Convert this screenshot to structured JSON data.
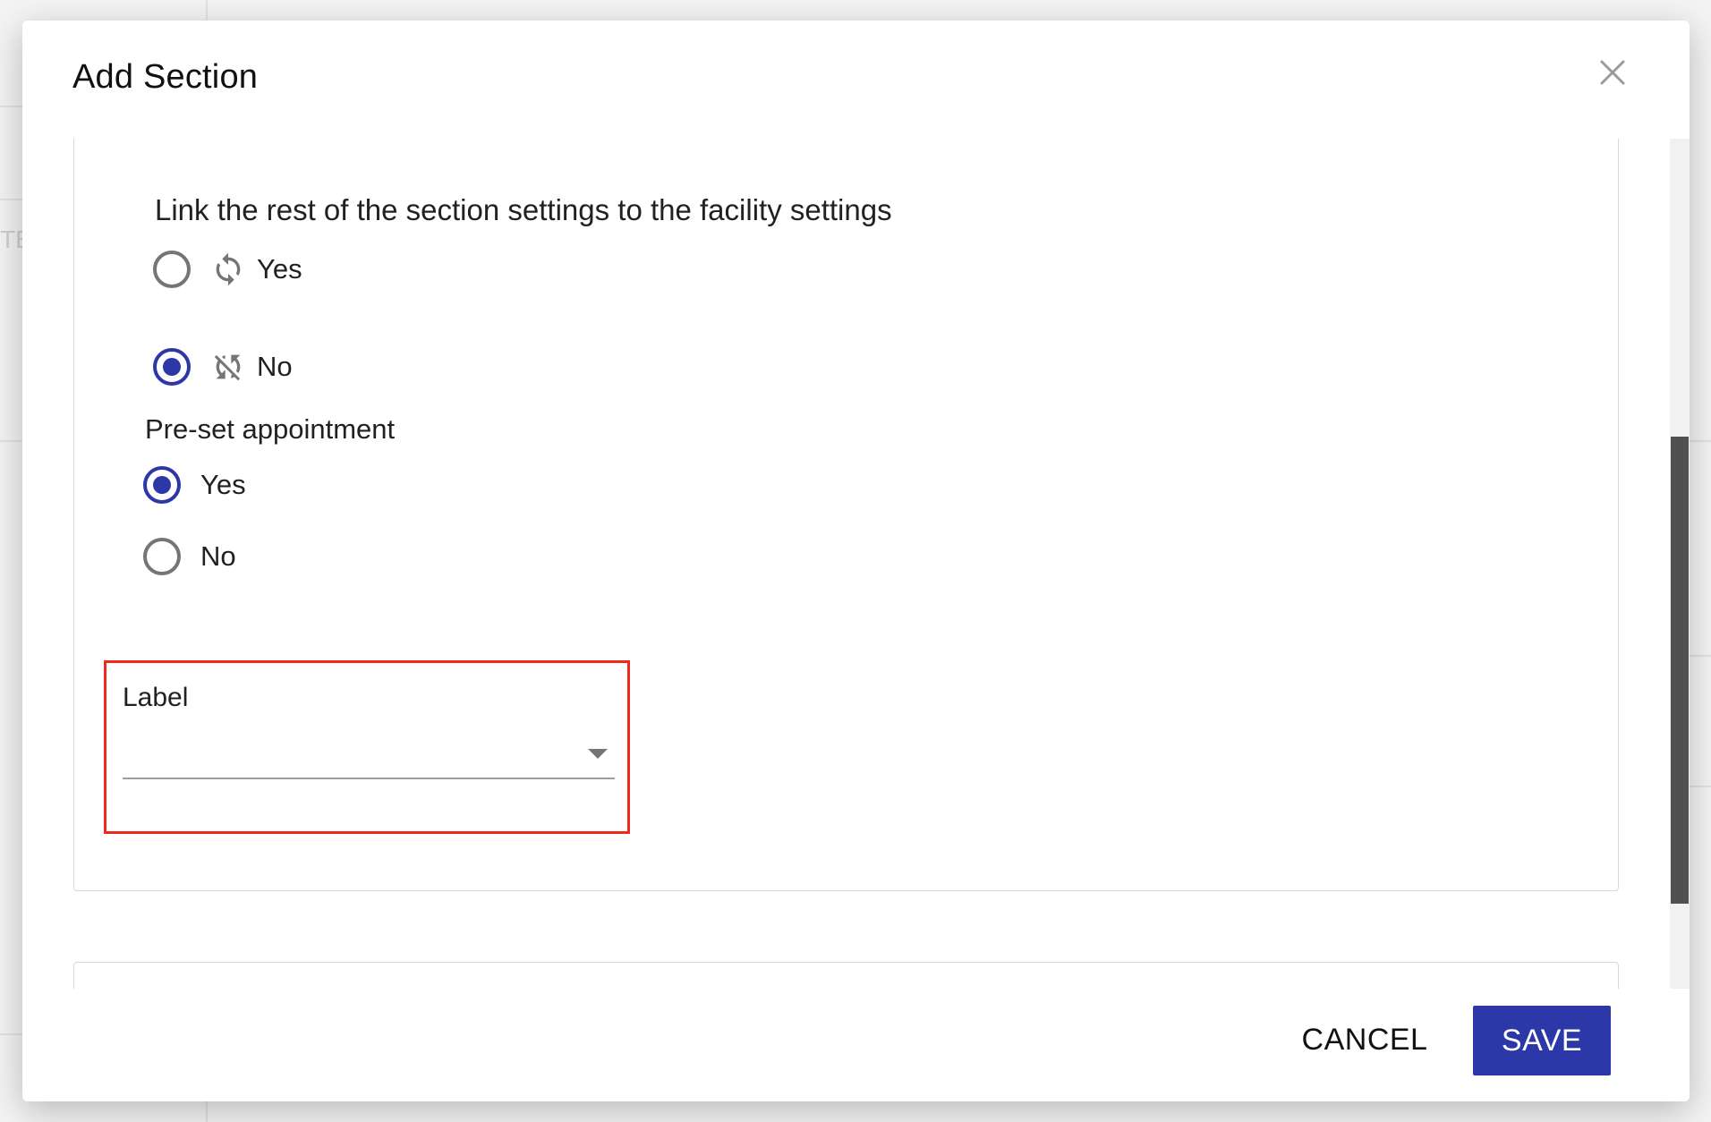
{
  "background": {
    "edge_text": "TE"
  },
  "modal": {
    "title": "Add Section",
    "close_icon": "close-icon"
  },
  "link_settings": {
    "question": "Link the rest of the section settings to the facility settings",
    "options": [
      {
        "label": "Yes",
        "icon": "sync-icon",
        "checked": false
      },
      {
        "label": "No",
        "icon": "sync-disabled-icon",
        "checked": true
      }
    ]
  },
  "preset_appointment": {
    "question": "Pre-set appointment",
    "options": [
      {
        "label": "Yes",
        "checked": true
      },
      {
        "label": "No",
        "checked": false
      }
    ]
  },
  "label_field": {
    "label": "Label",
    "value": ""
  },
  "footer": {
    "cancel_label": "CANCEL",
    "save_label": "SAVE"
  },
  "colors": {
    "primary": "#2c37a8",
    "highlight": "#ee2a1b",
    "radio_unchecked": "#757575"
  }
}
